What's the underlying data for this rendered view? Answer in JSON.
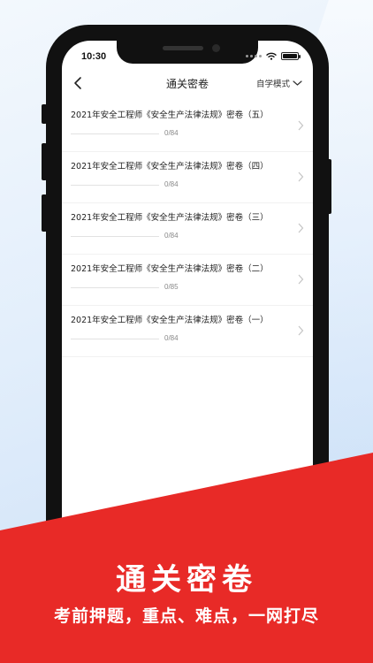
{
  "status_bar": {
    "time": "10:30"
  },
  "nav": {
    "title": "通关密卷",
    "mode_label": "自学模式"
  },
  "papers": [
    {
      "title": "2021年安全工程师《安全生产法律法规》密卷（五）",
      "progress": "0/84",
      "done": 0,
      "total": 84
    },
    {
      "title": "2021年安全工程师《安全生产法律法规》密卷（四）",
      "progress": "0/84",
      "done": 0,
      "total": 84
    },
    {
      "title": "2021年安全工程师《安全生产法律法规》密卷（三）",
      "progress": "0/84",
      "done": 0,
      "total": 84
    },
    {
      "title": "2021年安全工程师《安全生产法律法规》密卷（二）",
      "progress": "0/85",
      "done": 0,
      "total": 85
    },
    {
      "title": "2021年安全工程师《安全生产法律法规》密卷（一）",
      "progress": "0/84",
      "done": 0,
      "total": 84
    }
  ],
  "banner": {
    "title": "通关密卷",
    "subtitle": "考前押题，重点、难点，一网打尽"
  },
  "colors": {
    "accent": "#e82a27",
    "text": "#222222",
    "muted": "#888888"
  },
  "icons": {
    "back": "back-arrow-icon",
    "dropdown": "chevron-down-icon",
    "row": "chevron-right-icon"
  }
}
